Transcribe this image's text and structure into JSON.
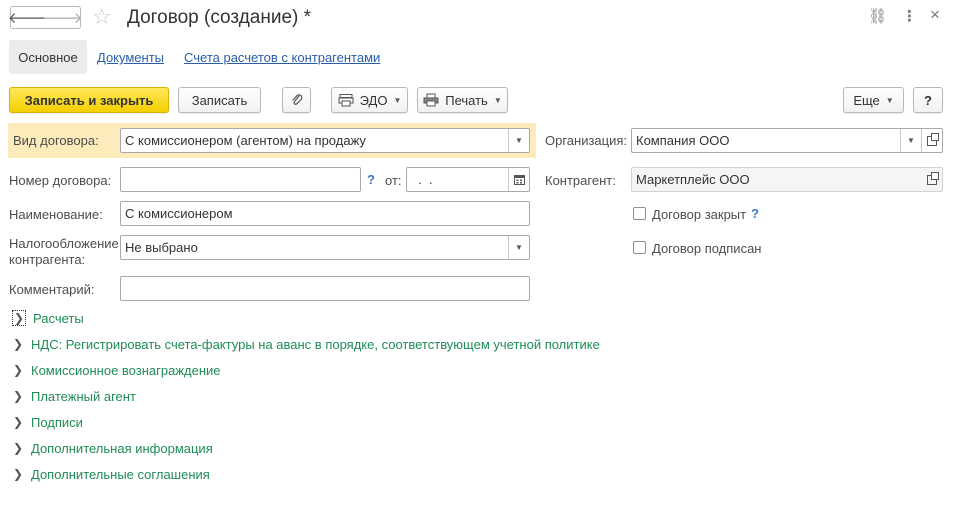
{
  "window": {
    "title": "Договор (создание) *",
    "back_icon": "arrow-left-icon",
    "forward_icon": "arrow-right-icon",
    "favorite_icon": "star-icon",
    "link_icon": "link-icon",
    "more_icon": "more-vertical-icon",
    "close_icon": "close-icon",
    "back_glyph": "🡐",
    "forward_glyph": "🡒",
    "star_glyph": "☆",
    "link_glyph": "⛓",
    "more_glyph": "⋮",
    "close_glyph": "×"
  },
  "tabs": [
    {
      "label": "Основное",
      "active": true
    },
    {
      "label": "Документы",
      "active": false
    },
    {
      "label": "Счета расчетов с контрагентами",
      "active": false
    }
  ],
  "toolbar": {
    "save_close_label": "Записать и закрыть",
    "save_label": "Записать",
    "attach_icon": "paperclip-icon",
    "edo_label": "ЭДО",
    "print_label": "Печать",
    "more_label": "Еще",
    "help_label": "?",
    "dropdown_glyph": "▼"
  },
  "form": {
    "contract_type": {
      "label": "Вид договора:",
      "value": "С комиссионером (агентом) на продажу"
    },
    "organization": {
      "label": "Организация:",
      "value": "Компания ООО"
    },
    "contract_number": {
      "label": "Номер договора:",
      "value": "",
      "help": "?",
      "date_label": "от:",
      "date_value": "  .  ."
    },
    "counterparty": {
      "label": "Контрагент:",
      "value": "Маркетплейс ООО"
    },
    "name": {
      "label": "Наименование:",
      "value": "С комиссионером"
    },
    "contract_closed": {
      "label": "Договор закрыт",
      "help": "?",
      "checked": false
    },
    "taxation": {
      "label_line1": "Налогообложение",
      "label_line2": "контрагента:",
      "value": "Не выбрано"
    },
    "contract_signed": {
      "label": "Договор подписан",
      "checked": false
    },
    "comment": {
      "label": "Комментарий:",
      "value": ""
    }
  },
  "sections": [
    {
      "label": "Расчеты"
    },
    {
      "label": "НДС: Регистрировать счета-фактуры на аванс в порядке, соответствующем учетной политике"
    },
    {
      "label": "Комиссионное вознаграждение"
    },
    {
      "label": "Платежный агент"
    },
    {
      "label": "Подписи"
    },
    {
      "label": "Дополнительная информация"
    },
    {
      "label": "Дополнительные соглашения"
    }
  ],
  "colors": {
    "primary_button": "#f4cf00",
    "highlight_band": "#fcecbc",
    "section_link": "#1f8c56",
    "tab_link": "#2a5ea8",
    "help_mark": "#3b79c4"
  }
}
